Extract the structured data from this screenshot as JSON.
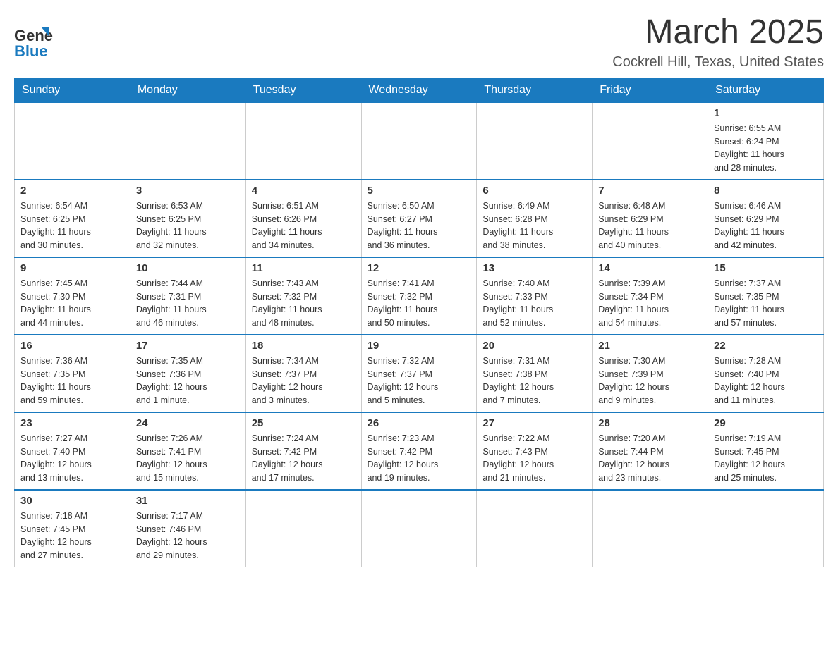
{
  "header": {
    "logo_line1": "General",
    "logo_line2": "Blue",
    "title": "March 2025",
    "location": "Cockrell Hill, Texas, United States"
  },
  "weekdays": [
    "Sunday",
    "Monday",
    "Tuesday",
    "Wednesday",
    "Thursday",
    "Friday",
    "Saturday"
  ],
  "weeks": [
    [
      {
        "day": "",
        "info": ""
      },
      {
        "day": "",
        "info": ""
      },
      {
        "day": "",
        "info": ""
      },
      {
        "day": "",
        "info": ""
      },
      {
        "day": "",
        "info": ""
      },
      {
        "day": "",
        "info": ""
      },
      {
        "day": "1",
        "info": "Sunrise: 6:55 AM\nSunset: 6:24 PM\nDaylight: 11 hours\nand 28 minutes."
      }
    ],
    [
      {
        "day": "2",
        "info": "Sunrise: 6:54 AM\nSunset: 6:25 PM\nDaylight: 11 hours\nand 30 minutes."
      },
      {
        "day": "3",
        "info": "Sunrise: 6:53 AM\nSunset: 6:25 PM\nDaylight: 11 hours\nand 32 minutes."
      },
      {
        "day": "4",
        "info": "Sunrise: 6:51 AM\nSunset: 6:26 PM\nDaylight: 11 hours\nand 34 minutes."
      },
      {
        "day": "5",
        "info": "Sunrise: 6:50 AM\nSunset: 6:27 PM\nDaylight: 11 hours\nand 36 minutes."
      },
      {
        "day": "6",
        "info": "Sunrise: 6:49 AM\nSunset: 6:28 PM\nDaylight: 11 hours\nand 38 minutes."
      },
      {
        "day": "7",
        "info": "Sunrise: 6:48 AM\nSunset: 6:29 PM\nDaylight: 11 hours\nand 40 minutes."
      },
      {
        "day": "8",
        "info": "Sunrise: 6:46 AM\nSunset: 6:29 PM\nDaylight: 11 hours\nand 42 minutes."
      }
    ],
    [
      {
        "day": "9",
        "info": "Sunrise: 7:45 AM\nSunset: 7:30 PM\nDaylight: 11 hours\nand 44 minutes."
      },
      {
        "day": "10",
        "info": "Sunrise: 7:44 AM\nSunset: 7:31 PM\nDaylight: 11 hours\nand 46 minutes."
      },
      {
        "day": "11",
        "info": "Sunrise: 7:43 AM\nSunset: 7:32 PM\nDaylight: 11 hours\nand 48 minutes."
      },
      {
        "day": "12",
        "info": "Sunrise: 7:41 AM\nSunset: 7:32 PM\nDaylight: 11 hours\nand 50 minutes."
      },
      {
        "day": "13",
        "info": "Sunrise: 7:40 AM\nSunset: 7:33 PM\nDaylight: 11 hours\nand 52 minutes."
      },
      {
        "day": "14",
        "info": "Sunrise: 7:39 AM\nSunset: 7:34 PM\nDaylight: 11 hours\nand 54 minutes."
      },
      {
        "day": "15",
        "info": "Sunrise: 7:37 AM\nSunset: 7:35 PM\nDaylight: 11 hours\nand 57 minutes."
      }
    ],
    [
      {
        "day": "16",
        "info": "Sunrise: 7:36 AM\nSunset: 7:35 PM\nDaylight: 11 hours\nand 59 minutes."
      },
      {
        "day": "17",
        "info": "Sunrise: 7:35 AM\nSunset: 7:36 PM\nDaylight: 12 hours\nand 1 minute."
      },
      {
        "day": "18",
        "info": "Sunrise: 7:34 AM\nSunset: 7:37 PM\nDaylight: 12 hours\nand 3 minutes."
      },
      {
        "day": "19",
        "info": "Sunrise: 7:32 AM\nSunset: 7:37 PM\nDaylight: 12 hours\nand 5 minutes."
      },
      {
        "day": "20",
        "info": "Sunrise: 7:31 AM\nSunset: 7:38 PM\nDaylight: 12 hours\nand 7 minutes."
      },
      {
        "day": "21",
        "info": "Sunrise: 7:30 AM\nSunset: 7:39 PM\nDaylight: 12 hours\nand 9 minutes."
      },
      {
        "day": "22",
        "info": "Sunrise: 7:28 AM\nSunset: 7:40 PM\nDaylight: 12 hours\nand 11 minutes."
      }
    ],
    [
      {
        "day": "23",
        "info": "Sunrise: 7:27 AM\nSunset: 7:40 PM\nDaylight: 12 hours\nand 13 minutes."
      },
      {
        "day": "24",
        "info": "Sunrise: 7:26 AM\nSunset: 7:41 PM\nDaylight: 12 hours\nand 15 minutes."
      },
      {
        "day": "25",
        "info": "Sunrise: 7:24 AM\nSunset: 7:42 PM\nDaylight: 12 hours\nand 17 minutes."
      },
      {
        "day": "26",
        "info": "Sunrise: 7:23 AM\nSunset: 7:42 PM\nDaylight: 12 hours\nand 19 minutes."
      },
      {
        "day": "27",
        "info": "Sunrise: 7:22 AM\nSunset: 7:43 PM\nDaylight: 12 hours\nand 21 minutes."
      },
      {
        "day": "28",
        "info": "Sunrise: 7:20 AM\nSunset: 7:44 PM\nDaylight: 12 hours\nand 23 minutes."
      },
      {
        "day": "29",
        "info": "Sunrise: 7:19 AM\nSunset: 7:45 PM\nDaylight: 12 hours\nand 25 minutes."
      }
    ],
    [
      {
        "day": "30",
        "info": "Sunrise: 7:18 AM\nSunset: 7:45 PM\nDaylight: 12 hours\nand 27 minutes."
      },
      {
        "day": "31",
        "info": "Sunrise: 7:17 AM\nSunset: 7:46 PM\nDaylight: 12 hours\nand 29 minutes."
      },
      {
        "day": "",
        "info": ""
      },
      {
        "day": "",
        "info": ""
      },
      {
        "day": "",
        "info": ""
      },
      {
        "day": "",
        "info": ""
      },
      {
        "day": "",
        "info": ""
      }
    ]
  ]
}
